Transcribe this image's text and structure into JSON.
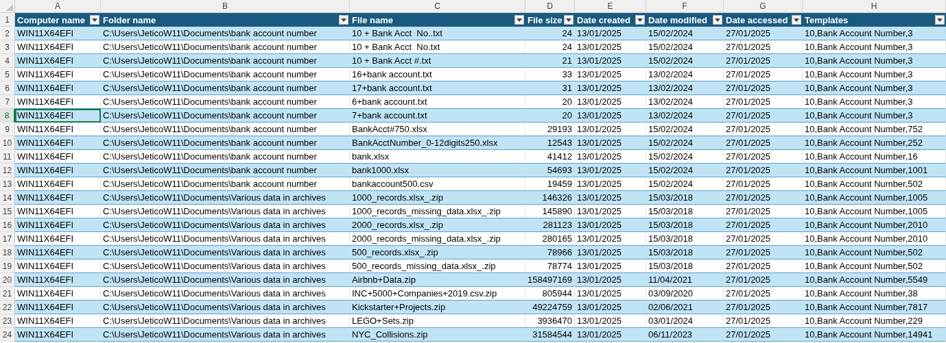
{
  "columns": [
    {
      "letter": "A",
      "heading": "Computer name",
      "kind": "text"
    },
    {
      "letter": "B",
      "heading": "Folder name",
      "kind": "text"
    },
    {
      "letter": "C",
      "heading": "File name",
      "kind": "text"
    },
    {
      "letter": "D",
      "heading": "File size",
      "kind": "number"
    },
    {
      "letter": "E",
      "heading": "Date created",
      "kind": "text"
    },
    {
      "letter": "F",
      "heading": "Date modified",
      "kind": "text"
    },
    {
      "letter": "G",
      "heading": "Date accessed",
      "kind": "text"
    },
    {
      "letter": "H",
      "heading": "Templates",
      "kind": "text"
    }
  ],
  "header_row_number": "1",
  "rows": [
    {
      "number": "2",
      "selected": false,
      "cells": [
        "WIN11X64EFI",
        "C:\\Users\\JeticoW11\\Documents\\bank account number",
        "10 + Bank Acct  No..txt",
        "24",
        "13/01/2025",
        "15/02/2024",
        "27/01/2025",
        "10,Bank Account Number,3"
      ]
    },
    {
      "number": "3",
      "selected": false,
      "cells": [
        "WIN11X64EFI",
        "C:\\Users\\JeticoW11\\Documents\\bank account number",
        "10 + Bank Acct  No.txt",
        "24",
        "13/01/2025",
        "15/02/2024",
        "27/01/2025",
        "10,Bank Account Number,3"
      ]
    },
    {
      "number": "4",
      "selected": false,
      "cells": [
        "WIN11X64EFI",
        "C:\\Users\\JeticoW11\\Documents\\bank account number",
        "10 + Bank Acct #.txt",
        "21",
        "13/01/2025",
        "15/02/2024",
        "27/01/2025",
        "10,Bank Account Number,3"
      ]
    },
    {
      "number": "5",
      "selected": false,
      "cells": [
        "WIN11X64EFI",
        "C:\\Users\\JeticoW11\\Documents\\bank account number",
        "16+bank account.txt",
        "33",
        "13/01/2025",
        "13/02/2024",
        "27/01/2025",
        "10,Bank Account Number,3"
      ]
    },
    {
      "number": "6",
      "selected": false,
      "cells": [
        "WIN11X64EFI",
        "C:\\Users\\JeticoW11\\Documents\\bank account number",
        "17+bank account.txt",
        "31",
        "13/01/2025",
        "13/02/2024",
        "27/01/2025",
        "10,Bank Account Number,3"
      ]
    },
    {
      "number": "7",
      "selected": false,
      "cells": [
        "WIN11X64EFI",
        "C:\\Users\\JeticoW11\\Documents\\bank account number",
        "6+bank account.txt",
        "20",
        "13/01/2025",
        "13/02/2024",
        "27/01/2025",
        "10,Bank Account Number,3"
      ]
    },
    {
      "number": "8",
      "selected": true,
      "cells": [
        "WIN11X64EFI",
        "C:\\Users\\JeticoW11\\Documents\\bank account number",
        "7+bank account.txt",
        "20",
        "13/01/2025",
        "13/02/2024",
        "27/01/2025",
        "10,Bank Account Number,3"
      ]
    },
    {
      "number": "9",
      "selected": false,
      "cells": [
        "WIN11X64EFI",
        "C:\\Users\\JeticoW11\\Documents\\bank account number",
        "BankAcct#750.xlsx",
        "29193",
        "13/01/2025",
        "15/02/2024",
        "27/01/2025",
        "10,Bank Account Number,752"
      ]
    },
    {
      "number": "10",
      "selected": false,
      "cells": [
        "WIN11X64EFI",
        "C:\\Users\\JeticoW11\\Documents\\bank account number",
        "BankAcctNumber_0-12digits250.xlsx",
        "12543",
        "13/01/2025",
        "15/02/2024",
        "27/01/2025",
        "10,Bank Account Number,252"
      ]
    },
    {
      "number": "11",
      "selected": false,
      "cells": [
        "WIN11X64EFI",
        "C:\\Users\\JeticoW11\\Documents\\bank account number",
        "bank.xlsx",
        "41412",
        "13/01/2025",
        "15/02/2024",
        "27/01/2025",
        "10,Bank Account Number,16"
      ]
    },
    {
      "number": "12",
      "selected": false,
      "cells": [
        "WIN11X64EFI",
        "C:\\Users\\JeticoW11\\Documents\\bank account number",
        "bank1000.xlsx",
        "54693",
        "13/01/2025",
        "15/02/2024",
        "27/01/2025",
        "10,Bank Account Number,1001"
      ]
    },
    {
      "number": "13",
      "selected": false,
      "cells": [
        "WIN11X64EFI",
        "C:\\Users\\JeticoW11\\Documents\\bank account number",
        "bankaccount500.csv",
        "19459",
        "13/01/2025",
        "15/02/2024",
        "27/01/2025",
        "10,Bank Account Number,502"
      ]
    },
    {
      "number": "14",
      "selected": false,
      "cells": [
        "WIN11X64EFI",
        "C:\\Users\\JeticoW11\\Documents\\Various data in archives",
        "1000_records.xlsx_.zip",
        "146326",
        "13/01/2025",
        "15/03/2018",
        "27/01/2025",
        "10,Bank Account Number,1005"
      ]
    },
    {
      "number": "15",
      "selected": false,
      "cells": [
        "WIN11X64EFI",
        "C:\\Users\\JeticoW11\\Documents\\Various data in archives",
        "1000_records_missing_data.xlsx_.zip",
        "145890",
        "13/01/2025",
        "15/03/2018",
        "27/01/2025",
        "10,Bank Account Number,1005"
      ]
    },
    {
      "number": "16",
      "selected": false,
      "cells": [
        "WIN11X64EFI",
        "C:\\Users\\JeticoW11\\Documents\\Various data in archives",
        "2000_records.xlsx_.zip",
        "281123",
        "13/01/2025",
        "15/03/2018",
        "27/01/2025",
        "10,Bank Account Number,2010"
      ]
    },
    {
      "number": "17",
      "selected": false,
      "cells": [
        "WIN11X64EFI",
        "C:\\Users\\JeticoW11\\Documents\\Various data in archives",
        "2000_records_missing_data.xlsx_.zip",
        "280165",
        "13/01/2025",
        "15/03/2018",
        "27/01/2025",
        "10,Bank Account Number,2010"
      ]
    },
    {
      "number": "18",
      "selected": false,
      "cells": [
        "WIN11X64EFI",
        "C:\\Users\\JeticoW11\\Documents\\Various data in archives",
        "500_records.xlsx_.zip",
        "78966",
        "13/01/2025",
        "15/03/2018",
        "27/01/2025",
        "10,Bank Account Number,502"
      ]
    },
    {
      "number": "19",
      "selected": false,
      "cells": [
        "WIN11X64EFI",
        "C:\\Users\\JeticoW11\\Documents\\Various data in archives",
        "500_records_missing_data.xlsx_.zip",
        "78774",
        "13/01/2025",
        "15/03/2018",
        "27/01/2025",
        "10,Bank Account Number,502"
      ]
    },
    {
      "number": "20",
      "selected": false,
      "cells": [
        "WIN11X64EFI",
        "C:\\Users\\JeticoW11\\Documents\\Various data in archives",
        "Airbnb+Data.zip",
        "158497169",
        "13/01/2025",
        "11/04/2021",
        "27/01/2025",
        "10,Bank Account Number,5549"
      ]
    },
    {
      "number": "21",
      "selected": false,
      "cells": [
        "WIN11X64EFI",
        "C:\\Users\\JeticoW11\\Documents\\Various data in archives",
        "INC+5000+Companies+2019.csv.zip",
        "805944",
        "13/01/2025",
        "03/09/2020",
        "27/01/2025",
        "10,Bank Account Number,38"
      ]
    },
    {
      "number": "22",
      "selected": false,
      "cells": [
        "WIN11X64EFI",
        "C:\\Users\\JeticoW11\\Documents\\Various data in archives",
        "Kickstarter+Projects.zip",
        "49224759",
        "13/01/2025",
        "02/06/2021",
        "27/01/2025",
        "10,Bank Account Number,7817"
      ]
    },
    {
      "number": "23",
      "selected": false,
      "cells": [
        "WIN11X64EFI",
        "C:\\Users\\JeticoW11\\Documents\\Various data in archives",
        "LEGO+Sets.zip",
        "3936470",
        "13/01/2025",
        "03/01/2024",
        "27/01/2025",
        "10,Bank Account Number,229"
      ]
    },
    {
      "number": "24",
      "selected": false,
      "cells": [
        "WIN11X64EFI",
        "C:\\Users\\JeticoW11\\Documents\\Various data in archives",
        "NYC_Collisions.zip",
        "31584544",
        "13/01/2025",
        "06/11/2023",
        "27/01/2025",
        "10,Bank Account Number,14941"
      ]
    }
  ]
}
